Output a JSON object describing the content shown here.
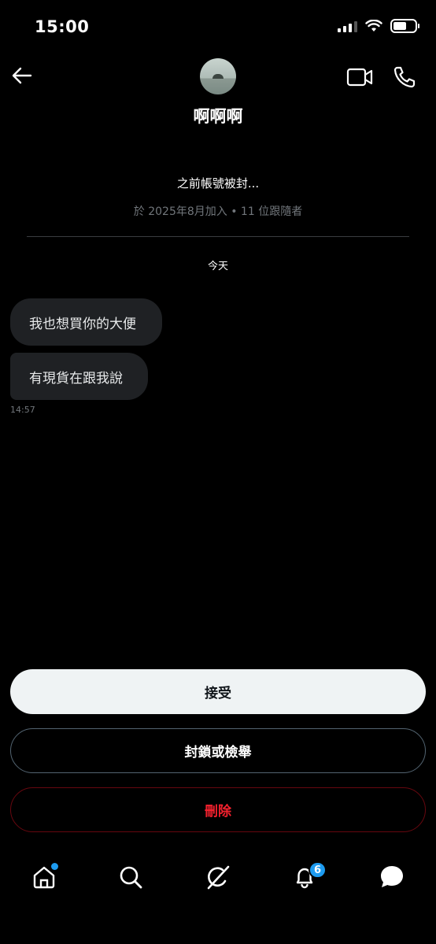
{
  "status_bar": {
    "time": "15:00"
  },
  "header": {
    "contact_name": "啊啊啊"
  },
  "profile": {
    "bio": "之前帳號被封...",
    "joined": "於 2025年8月加入 • 11 位跟隨者"
  },
  "conversation": {
    "day_label": "今天",
    "messages": [
      {
        "text": "我也想買你的大便"
      },
      {
        "text": "有現貨在跟我說"
      }
    ],
    "last_time": "14:57"
  },
  "actions": {
    "accept": "接受",
    "block_or_report": "封鎖或檢舉",
    "delete": "刪除"
  },
  "tab_bar": {
    "notifications_badge": "6",
    "home_has_dot": true
  },
  "colors": {
    "accent": "#1d9bf0",
    "danger": "#f4212e",
    "bubble": "#1f2124"
  }
}
